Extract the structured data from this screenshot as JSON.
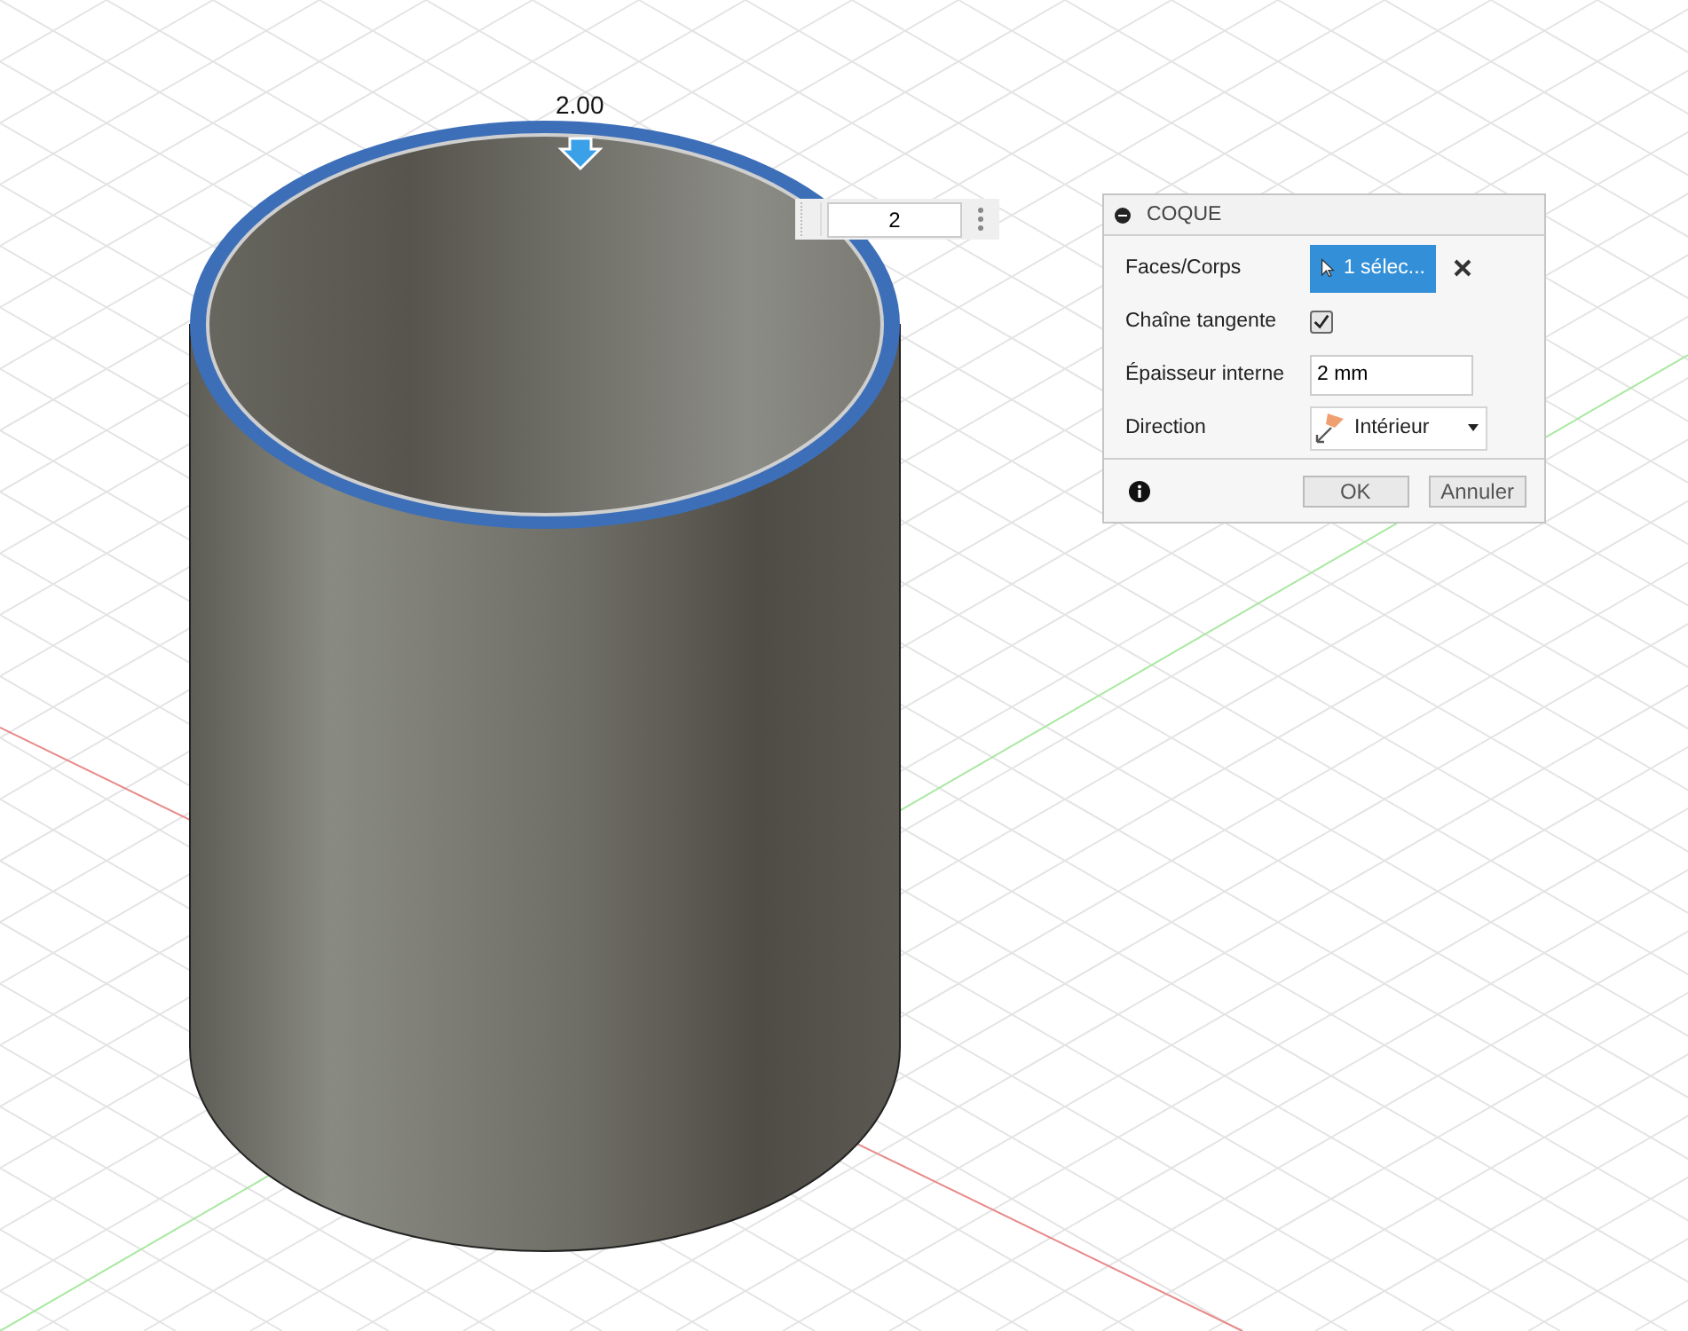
{
  "viewport": {
    "dimension_label": "2.00",
    "dimension_input": {
      "value": "2"
    }
  },
  "dialog": {
    "title": "COQUE",
    "rows": [
      {
        "kind": "selection",
        "label": "Faces/Corps",
        "value": "1 sélec..."
      },
      {
        "kind": "checkbox",
        "label": "Chaîne tangente",
        "checked": true
      },
      {
        "kind": "input",
        "label": "Épaisseur interne",
        "value": "2 mm"
      },
      {
        "kind": "dropdown",
        "label": "Direction",
        "value": "Intérieur"
      }
    ],
    "buttons": [
      {
        "label": "OK"
      },
      {
        "label": "Annuler"
      }
    ]
  }
}
